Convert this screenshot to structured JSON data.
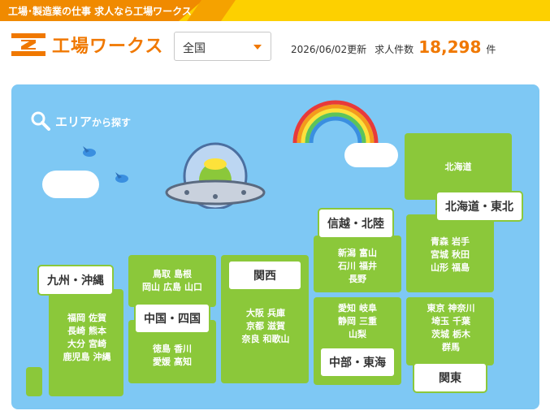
{
  "topbar": {
    "tagline": "工場･製造業の仕事 求人なら工場ワークス"
  },
  "header": {
    "logo_text": "工場ワークス",
    "region_select": {
      "value": "全国"
    },
    "updated": "2026/06/02更新",
    "jobs_label": "求人件数",
    "jobs_count": "18,298",
    "jobs_unit": "件"
  },
  "map": {
    "search_title": "エリア",
    "search_title_suffix": "から探す",
    "regions": [
      {
        "label": "北海道・東北",
        "prefectures": [
          [
            "北海道"
          ],
          [
            "青森",
            "岩手"
          ],
          [
            "宮城",
            "秋田"
          ],
          [
            "山形",
            "福島"
          ]
        ]
      },
      {
        "label": "信越・北陸",
        "prefectures": [
          [
            "新潟",
            "富山"
          ],
          [
            "石川",
            "福井"
          ],
          [
            "長野"
          ]
        ]
      },
      {
        "label": "関東",
        "prefectures": [
          [
            "東京",
            "神奈川"
          ],
          [
            "埼玉",
            "千葉"
          ],
          [
            "茨城",
            "栃木"
          ],
          [
            "群馬"
          ]
        ]
      },
      {
        "label": "中部・東海",
        "prefectures": [
          [
            "愛知",
            "岐阜"
          ],
          [
            "静岡",
            "三重"
          ],
          [
            "山梨"
          ]
        ]
      },
      {
        "label": "関西",
        "prefectures": [
          [
            "大阪",
            "兵庫"
          ],
          [
            "京都",
            "滋賀"
          ],
          [
            "奈良",
            "和歌山"
          ]
        ]
      },
      {
        "label": "中国・四国",
        "prefectures": [
          [
            "鳥取",
            "島根"
          ],
          [
            "岡山",
            "広島",
            "山口"
          ],
          [
            "徳島",
            "香川"
          ],
          [
            "愛媛",
            "高知"
          ]
        ]
      },
      {
        "label": "九州・沖縄",
        "prefectures": [
          [
            "福岡",
            "佐賀"
          ],
          [
            "長崎",
            "熊本"
          ],
          [
            "大分",
            "宮崎"
          ],
          [
            "鹿児島",
            "沖縄"
          ]
        ]
      }
    ]
  },
  "colors": {
    "accent": "#f07800",
    "map_bg": "#7ec8f4",
    "land": "#8bc83a",
    "topbar": "#fdd000"
  }
}
